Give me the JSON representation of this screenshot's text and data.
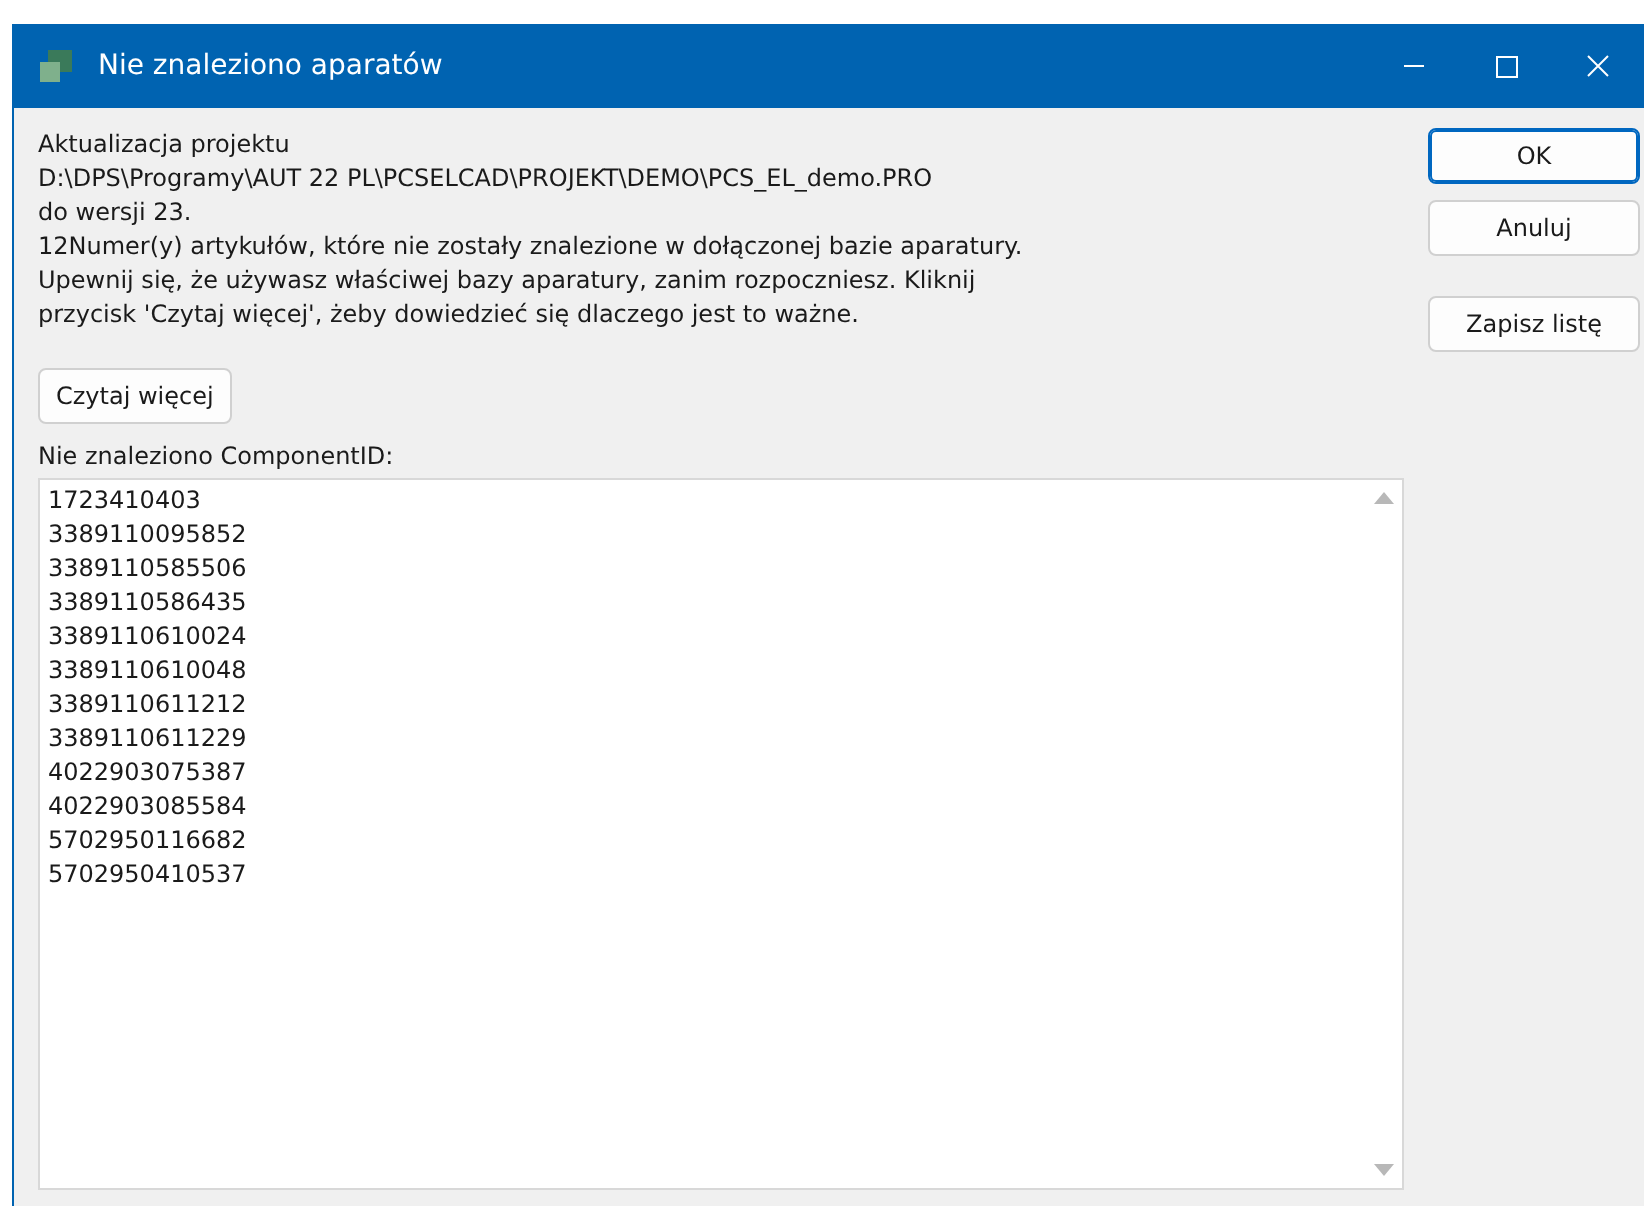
{
  "window": {
    "title": "Nie znaleziono aparatów"
  },
  "message_lines": [
    "Aktualizacja projektu",
    "D:\\DPS\\Programy\\AUT 22 PL\\PCSELCAD\\PROJEKT\\DEMO\\PCS_EL_demo.PRO",
    "do wersji 23.",
    "12Numer(y) artykułów, które nie zostały znalezione w dołączonej bazie aparatury.",
    "Upewnij się, że używasz właściwej bazy aparatury, zanim rozpoczniesz. Kliknij",
    "przycisk 'Czytaj więcej', żeby dowiedzieć się dlaczego jest to ważne."
  ],
  "read_more_button": "Czytaj więcej",
  "list_label": "Nie znaleziono ComponentID:",
  "component_ids": [
    "1723410403",
    "3389110095852",
    "3389110585506",
    "3389110586435",
    "3389110610024",
    "3389110610048",
    "3389110611212",
    "3389110611229",
    "4022903075387",
    "4022903085584",
    "5702950116682",
    "5702950410537"
  ],
  "side_buttons": [
    {
      "label": "OK",
      "default": true
    },
    {
      "label": "Anuluj",
      "default": false
    },
    {
      "label": "Zapisz listę",
      "default": false
    }
  ]
}
